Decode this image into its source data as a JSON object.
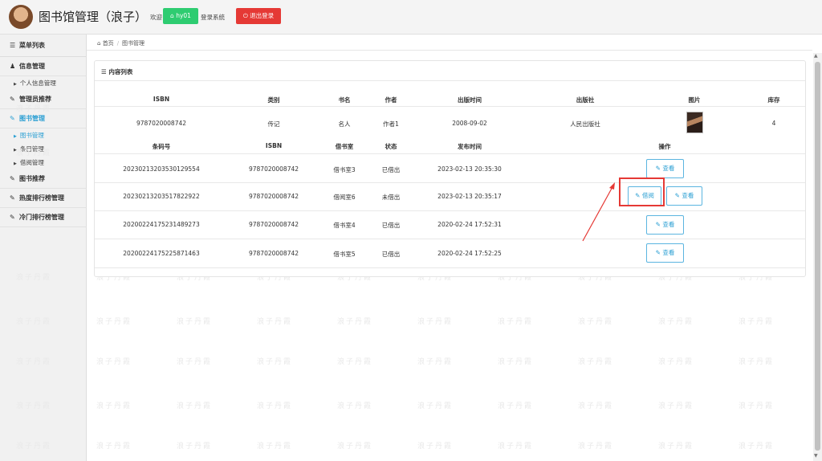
{
  "header": {
    "title": "图书馆管理（浪子）",
    "welcome": "欢迎",
    "user_label": "hy01",
    "login_text": "登录系统",
    "logout_label": "退出登录",
    "user_icon": "home-icon",
    "logout_icon": "power-icon"
  },
  "sidebar": {
    "menu_title": "菜单列表",
    "groups": [
      {
        "label": "信息管理",
        "icon": "user-icon"
      },
      {
        "label": "管理员推荐",
        "icon": "edit-icon"
      },
      {
        "label": "图书管理",
        "icon": "edit-icon"
      },
      {
        "label": "图书推荐",
        "icon": "edit-icon"
      },
      {
        "label": "热度排行榜管理",
        "icon": "edit-icon"
      },
      {
        "label": "冷门排行榜管理",
        "icon": "edit-icon"
      }
    ],
    "info_sub": [
      "个人信息管理"
    ],
    "book_sub": [
      "图书管理",
      "条目管理",
      "借阅管理"
    ]
  },
  "breadcrumb": {
    "home": "首页",
    "current": "图书管理"
  },
  "panel": {
    "title": "内容列表"
  },
  "book_table": {
    "headers": [
      "ISBN",
      "类别",
      "书名",
      "作者",
      "出版时间",
      "出版社",
      "图片",
      "库存"
    ],
    "row": [
      "9787020008742",
      "传记",
      "名人",
      "作者1",
      "2008-09-02",
      "人民出版社",
      "",
      "4"
    ]
  },
  "copy_table": {
    "headers": [
      "条码号",
      "ISBN",
      "借书室",
      "状态",
      "发布时间",
      "操作"
    ],
    "rows": [
      [
        "20230213203530129554",
        "9787020008742",
        "借书室3",
        "已借出",
        "2023-02-13 20:35:30"
      ],
      [
        "20230213203517822922",
        "9787020008742",
        "借阅室6",
        "未借出",
        "2023-02-13 20:35:17"
      ],
      [
        "20200224175231489273",
        "9787020008742",
        "借书室4",
        "已借出",
        "2020-02-24 17:52:31"
      ],
      [
        "20200224175225871463",
        "9787020008742",
        "借书室5",
        "已借出",
        "2020-02-24 17:52:25"
      ]
    ],
    "view_label": "查看",
    "borrow_label": "借阅"
  },
  "watermark": "浪子丹霞",
  "colors": {
    "accent": "#2b9fd3",
    "success": "#2ecc71",
    "danger": "#e53935"
  }
}
